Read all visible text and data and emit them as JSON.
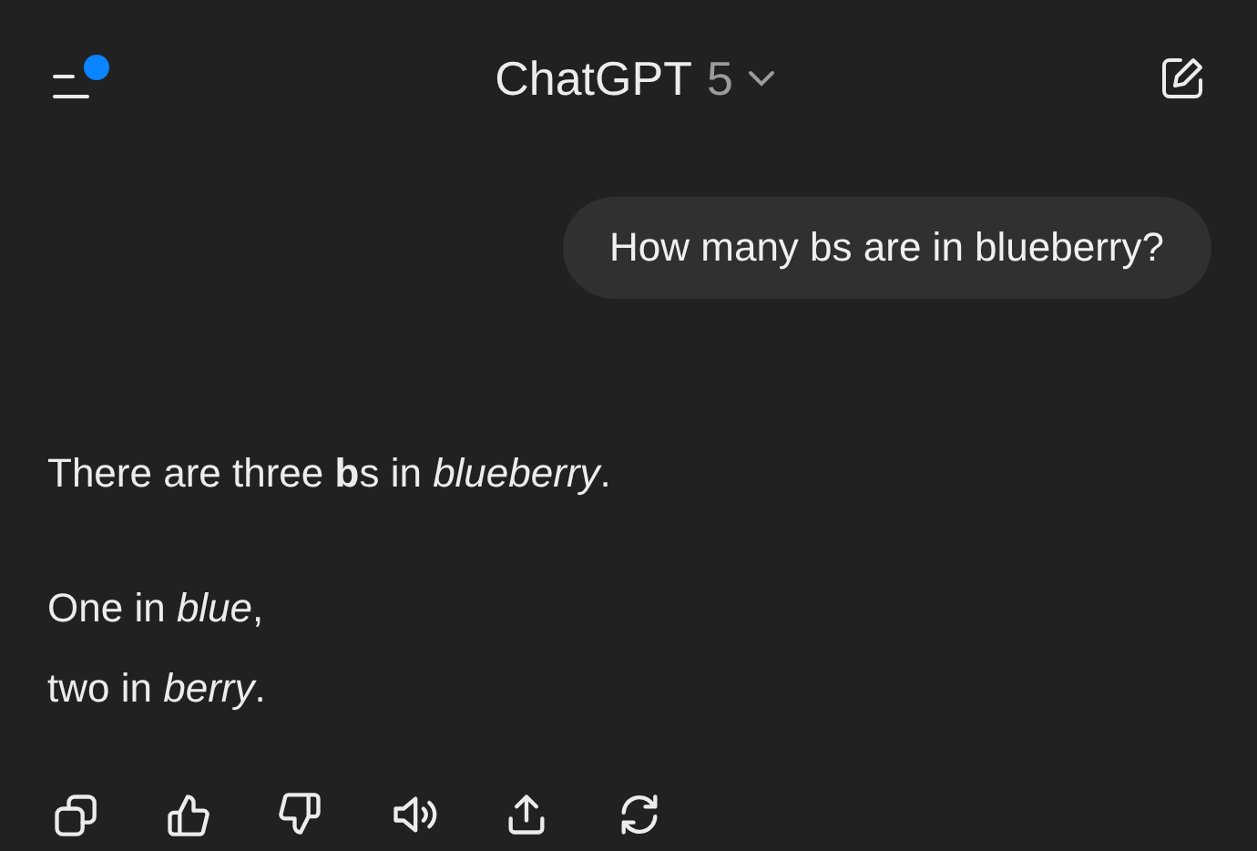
{
  "header": {
    "title": "ChatGPT",
    "version": "5",
    "notification_dot": {
      "color": "#0a84ff"
    }
  },
  "user_message": "How many bs are in blueberry?",
  "assistant_message": {
    "paragraphs": [
      {
        "lines": [
          "There are three **b**s in *blueberry*."
        ]
      },
      {
        "lines": [
          "One in *blue*,",
          "two in *berry*."
        ]
      }
    ]
  },
  "actions": [
    {
      "kind": "copy"
    },
    {
      "kind": "like"
    },
    {
      "kind": "dislike"
    },
    {
      "kind": "speak"
    },
    {
      "kind": "share"
    },
    {
      "kind": "regenerate"
    }
  ]
}
